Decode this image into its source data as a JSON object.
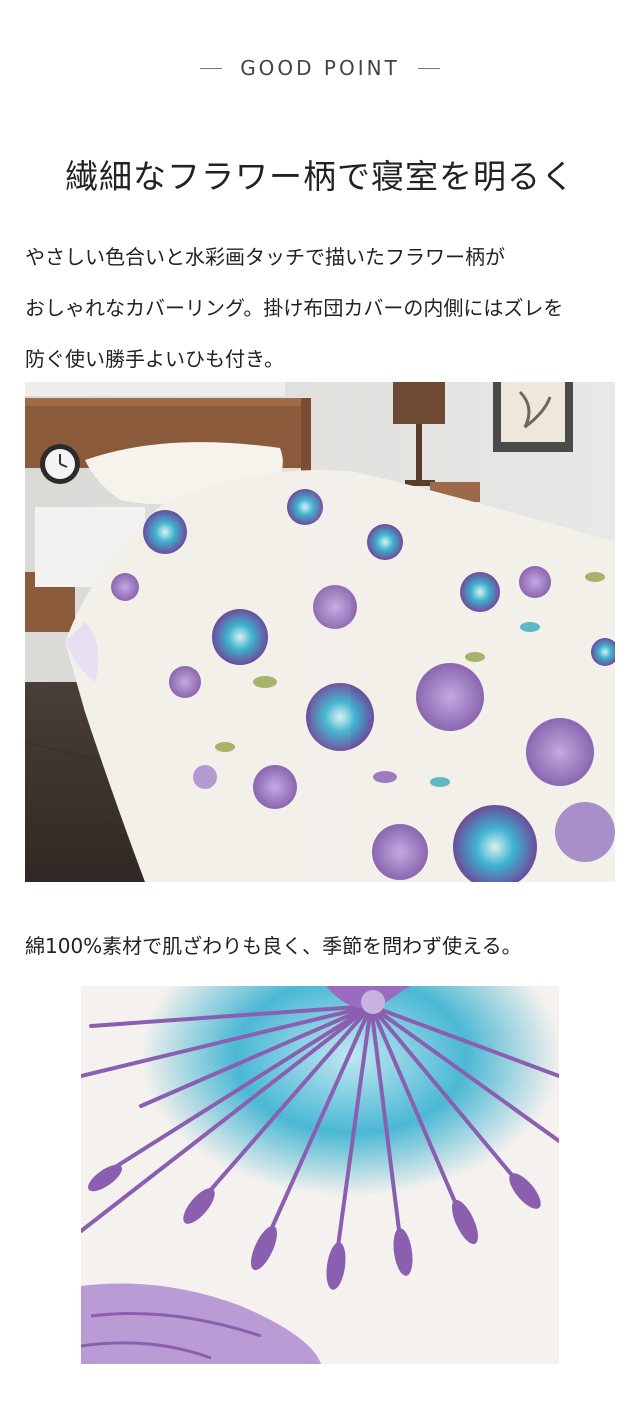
{
  "section": {
    "eyebrow": "GOOD POINT",
    "headline": "繊細なフラワー柄で寝室を明るく",
    "description_lines": [
      "やさしい色合いと水彩画タッチで描いたフラワー柄が",
      "おしゃれなカバーリング。掛け布団カバーの内側にはズレを",
      "防ぐ使い勝手よいひも付き。"
    ],
    "detail_text": "綿100%素材で肌ざわりも良く、季節を問わず使える。"
  },
  "images": [
    {
      "subject": "bed-with-floral-duvet-cover"
    },
    {
      "subject": "closeup-of-floral-fabric-print"
    }
  ],
  "colors": {
    "text": "#222222",
    "purple": "#8a66b0",
    "turquoise": "#3fb2cf",
    "fabric": "#f3efe9"
  }
}
